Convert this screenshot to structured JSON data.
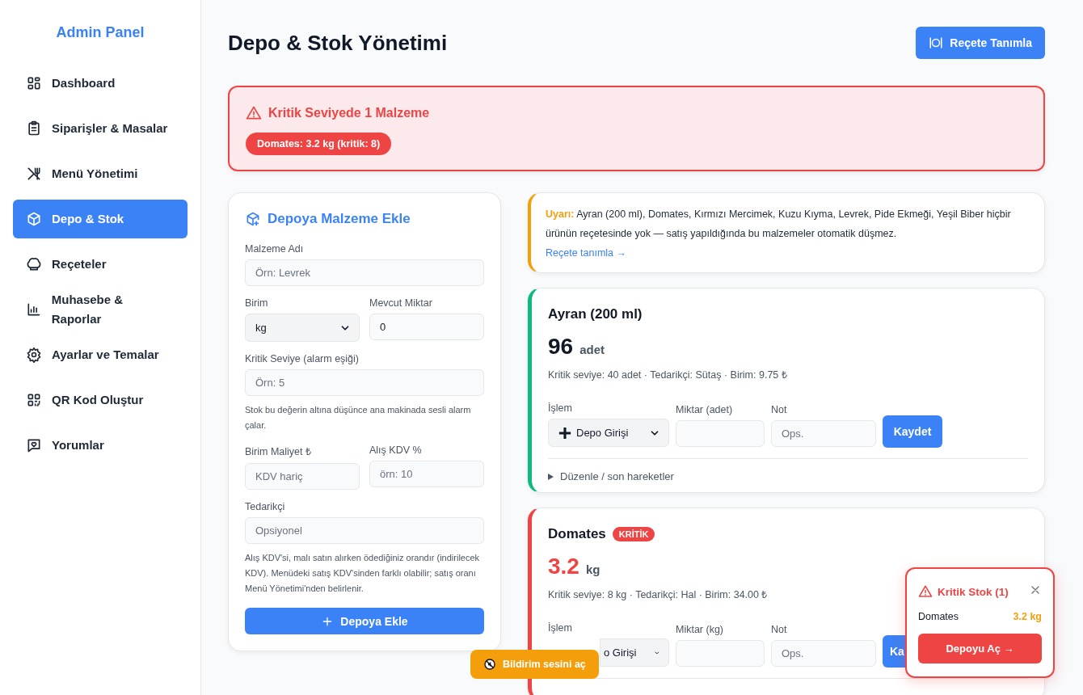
{
  "sidebar": {
    "title": "Admin Panel",
    "items": [
      {
        "label": "Dashboard",
        "selected": false
      },
      {
        "label": "Siparişler & Masalar",
        "selected": false
      },
      {
        "label": "Menü Yönetimi",
        "selected": false
      },
      {
        "label": "Depo & Stok",
        "selected": true
      },
      {
        "label": "Reçeteler",
        "selected": false
      },
      {
        "label": "Muhasebe & Raporlar",
        "selected": false
      },
      {
        "label": "Ayarlar ve Temalar",
        "selected": false
      },
      {
        "label": "QR Kod Oluştur",
        "selected": false
      },
      {
        "label": "Yorumlar",
        "selected": false
      }
    ]
  },
  "header": {
    "title": "Depo & Stok Yönetimi",
    "button": "Reçete Tanımla"
  },
  "critical_banner": {
    "title": "Kritik Seviyede 1 Malzeme",
    "items": [
      "Domates: 3.2 kg (kritik: 8)"
    ]
  },
  "add_form": {
    "title": "Depoya Malzeme Ekle",
    "rows": [
      {
        "fields": [
          {
            "kind": "text",
            "label": "Malzeme Adı",
            "placeholder": "Örn: Levrek"
          }
        ]
      },
      {
        "fields": [
          {
            "kind": "select",
            "label": "Birim",
            "value": "kg"
          },
          {
            "kind": "text",
            "label": "Mevcut Miktar",
            "value": "0"
          }
        ]
      },
      {
        "fields": [
          {
            "kind": "text",
            "label": "Kritik Seviye (alarm eşiği)",
            "placeholder": "Örn: 5"
          }
        ],
        "help": "Stok bu değerin altına düşünce ana makinada sesli alarm çalar."
      },
      {
        "fields": [
          {
            "kind": "text",
            "label": "Birim Maliyet ₺",
            "placeholder": "KDV hariç"
          },
          {
            "kind": "text",
            "label": "Alış KDV %",
            "placeholder": "örn: 10"
          }
        ]
      },
      {
        "fields": [
          {
            "kind": "text",
            "label": "Tedarikçi",
            "placeholder": "Opsiyonel"
          }
        ],
        "help": "Alış KDV'si, malı satın alırken ödediğiniz orandır (indirilecek KDV). Menüdeki satış KDV'sinden farklı olabilir; satış oranı Menü Yönetimi'nden belirlenir."
      }
    ],
    "submit": "Depoya Ekle"
  },
  "warning": {
    "text": "**Uyarı:** Ayran (200 ml), Domates, Kırmızı Mercimek, Kuzu Kıyma, Levrek, Pide Ekmeği, Yeşil Biber hiçbir ürünün reçetesinde yok — satış yapıldığında bu malzemeler otomatik düşmez.",
    "link": "Reçete tanımla →"
  },
  "stock_items": [
    {
      "name": "Ayran (200 ml)",
      "critical": false,
      "amount": "96",
      "unit": "adet",
      "meta": "Kritik seviye: 40 adet · Tedarikçi: Sütaş · Birim: 9.75 ₺",
      "operation_label": "İşlem",
      "operation_icon": true,
      "operation": "Depo Girişi",
      "qty_label": "Miktar (adet)",
      "note_label": "Not",
      "note_placeholder": "Ops.",
      "save": "Kaydet",
      "details": "Düzenle / son hareketler"
    },
    {
      "name": "Domates",
      "critical": true,
      "badge": "KRİTİK",
      "amount": "3.2",
      "unit": "kg",
      "meta": "Kritik seviye: 8 kg · Tedarikçi: Hal · Birim: 34.00 ₺",
      "operation_label": "İşlem",
      "operation_icon": false,
      "operation": "o Girişi",
      "qty_label": "Miktar (kg)",
      "note_label": "Not",
      "note_placeholder": "Ops.",
      "save": "Ka"
    }
  ],
  "toast": {
    "title": "Kritik Stok (1)",
    "rows": [
      {
        "name": "Domates",
        "amount": "3.2 kg"
      }
    ],
    "button": "Depoyu Aç →"
  },
  "sound_button": "Bildirim sesini aç"
}
